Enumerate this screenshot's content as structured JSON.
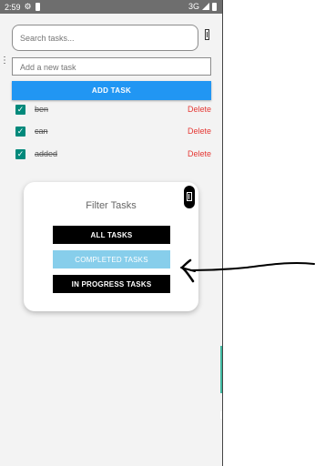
{
  "status_bar": {
    "time": "2:59",
    "network": "3G",
    "left_icons": [
      "gear-icon",
      "sd-card-icon"
    ],
    "right_icons": [
      "signal-icon",
      "battery-icon"
    ]
  },
  "search": {
    "placeholder": "Search tasks...",
    "value": ""
  },
  "new_task": {
    "placeholder": "Add a new task",
    "value": ""
  },
  "add_button_label": "ADD TASK",
  "tasks": [
    {
      "text": "ben",
      "completed": true,
      "delete_label": "Delete"
    },
    {
      "text": "can",
      "completed": true,
      "delete_label": "Delete"
    },
    {
      "text": "added",
      "completed": true,
      "delete_label": "Delete"
    }
  ],
  "filter_modal": {
    "title": "Filter Tasks",
    "buttons": [
      {
        "label": "ALL TASKS",
        "selected": false
      },
      {
        "label": "COMPLETED TASKS",
        "selected": true
      },
      {
        "label": "IN PROGRESS TASKS",
        "selected": false
      }
    ]
  },
  "colors": {
    "accent": "#2196f3",
    "checkbox": "#00897b",
    "delete": "#e53935",
    "selected_filter": "#87ceeb",
    "filter_button": "#000000"
  }
}
